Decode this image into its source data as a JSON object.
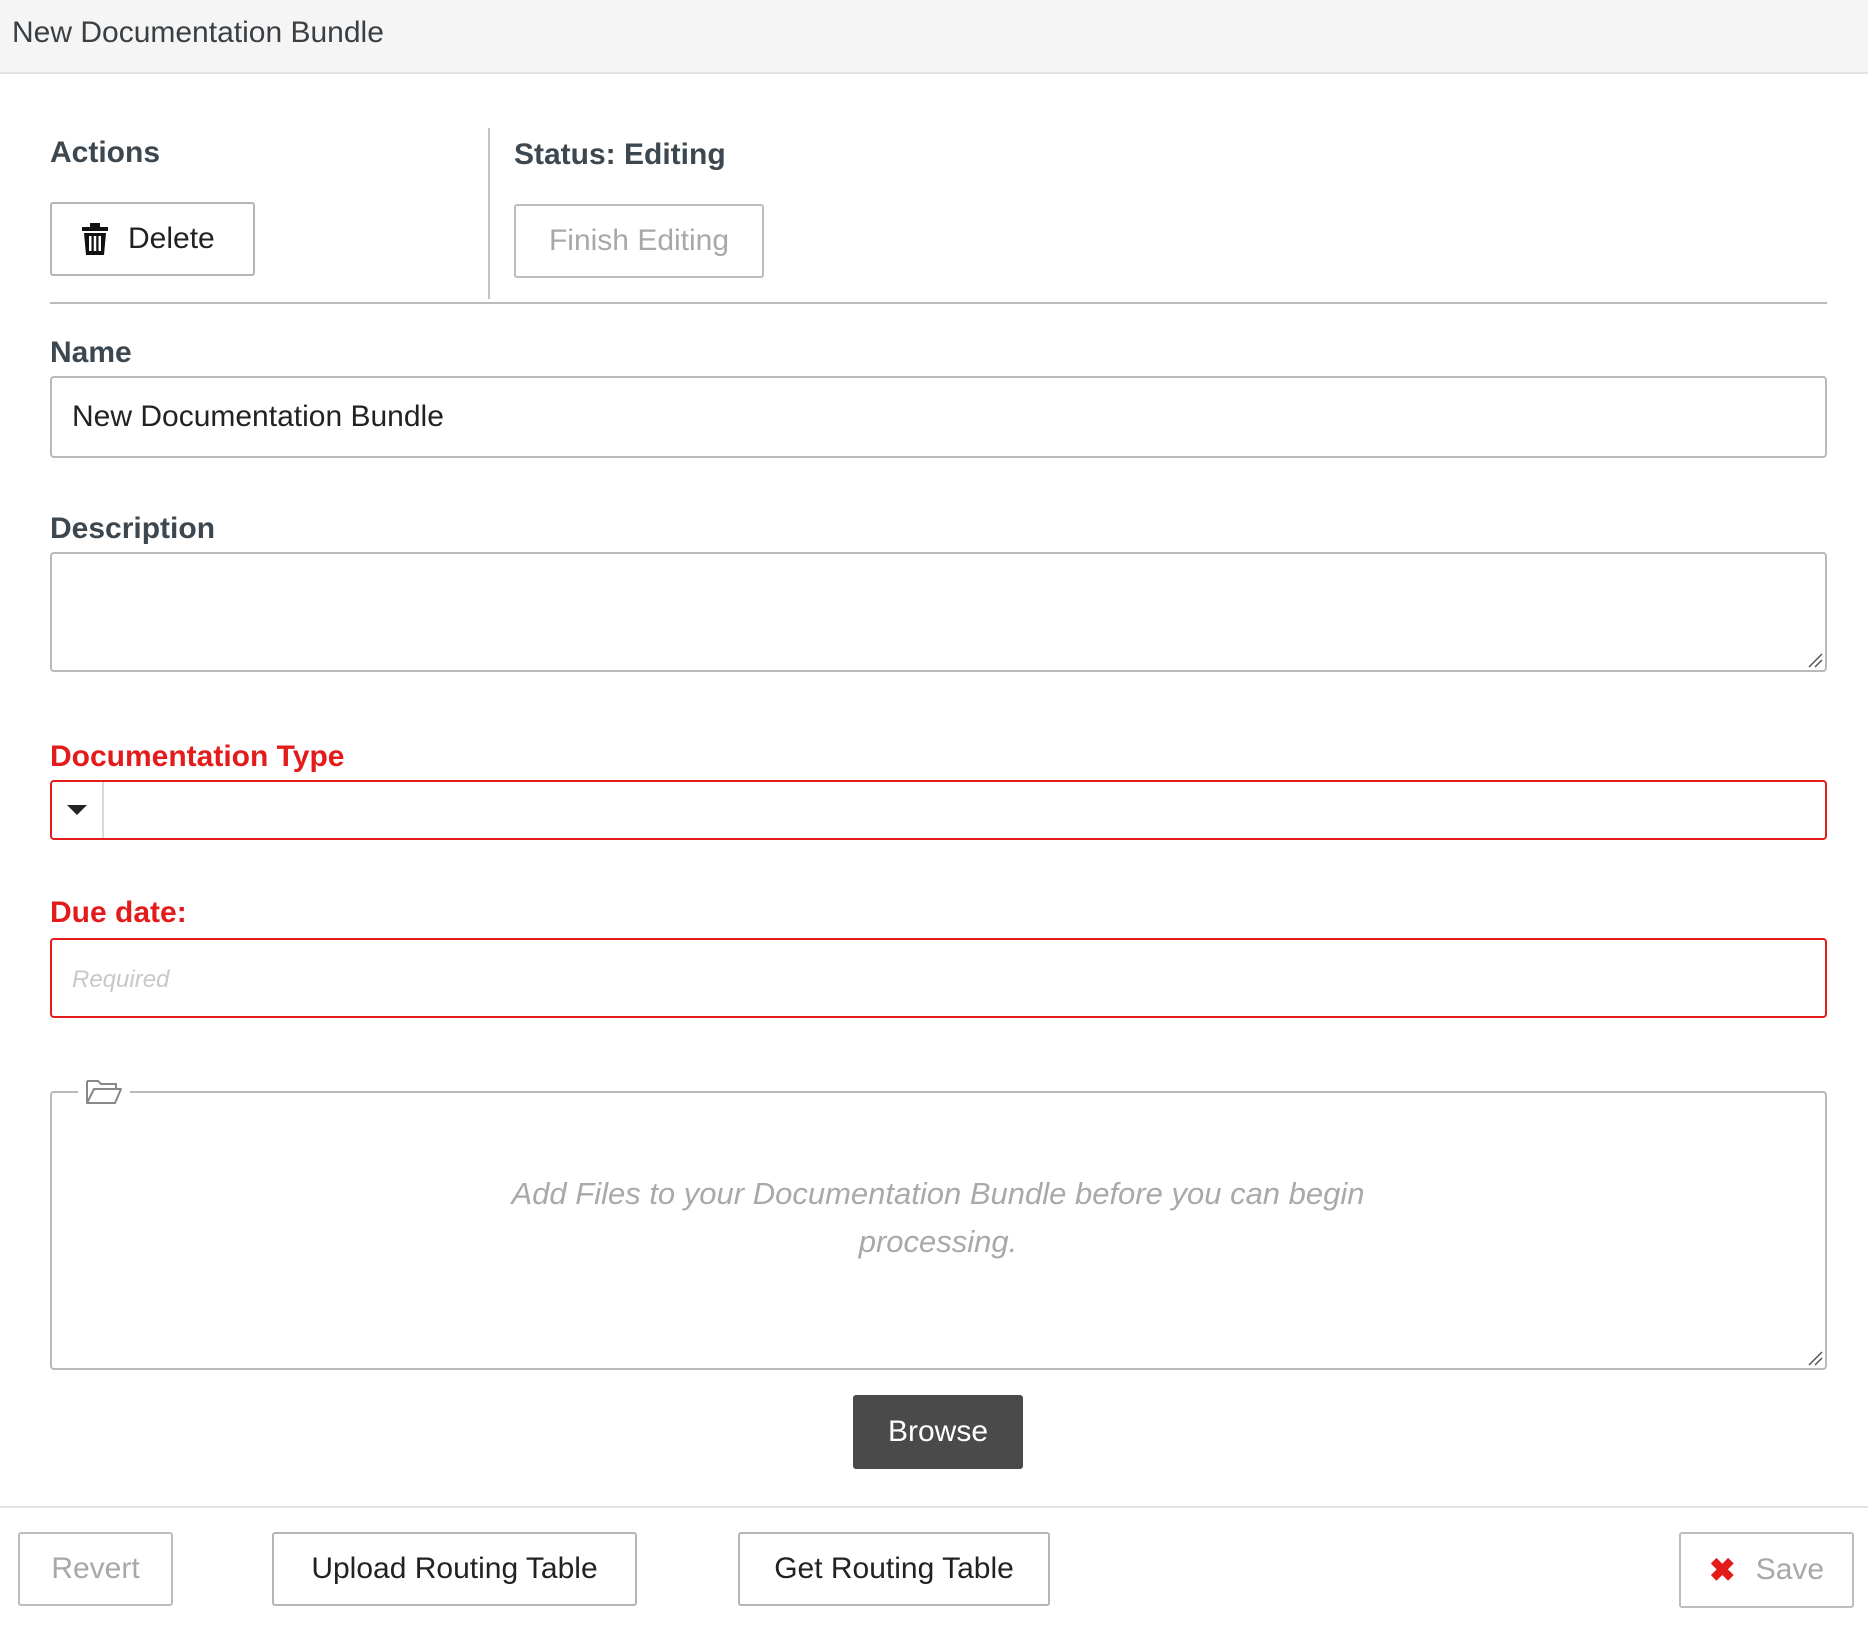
{
  "window": {
    "title": "New Documentation Bundle"
  },
  "actions": {
    "label": "Actions",
    "delete_label": "Delete",
    "delete_icon": "trash-icon"
  },
  "status": {
    "label": "Status: Editing",
    "finish_label": "Finish Editing"
  },
  "form": {
    "name": {
      "label": "Name",
      "value": "New Documentation Bundle"
    },
    "description": {
      "label": "Description",
      "value": ""
    },
    "documentation_type": {
      "label": "Documentation Type",
      "value": ""
    },
    "due_date": {
      "label": "Due date:",
      "placeholder": "Required",
      "value": ""
    }
  },
  "files": {
    "icon": "folder-open-icon",
    "empty_message": "Add Files to your Documentation Bundle before you can begin processing.",
    "browse_label": "Browse"
  },
  "footer": {
    "revert_label": "Revert",
    "upload_label": "Upload Routing Table",
    "get_label": "Get Routing Table",
    "save_label": "Save",
    "save_icon": "close-icon"
  },
  "colors": {
    "required": "#e31b1b",
    "browse_bg": "#4a4a4a",
    "titlebar_bg": "#f5f5f5"
  }
}
